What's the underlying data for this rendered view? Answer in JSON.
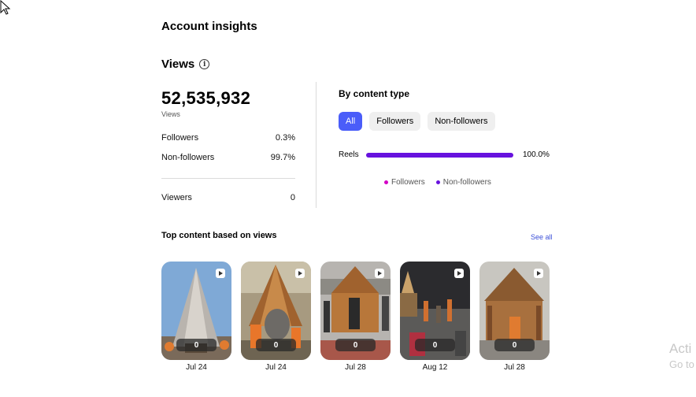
{
  "header": {
    "title": "Account insights"
  },
  "views": {
    "heading": "Views",
    "total": "52,535,932",
    "total_label": "Views",
    "followers_label": "Followers",
    "followers_pct": "0.3%",
    "nonfollowers_label": "Non-followers",
    "nonfollowers_pct": "99.7%",
    "viewers_label": "Viewers",
    "viewers_value": "0"
  },
  "by_content": {
    "title": "By content type",
    "tabs": [
      "All",
      "Followers",
      "Non-followers"
    ],
    "active_tab": "All",
    "bar_label": "Reels",
    "bar_value": "100.0%",
    "bar_fraction": 1.0,
    "legend": [
      {
        "label": "Followers",
        "color": "#d300c5"
      },
      {
        "label": "Non-followers",
        "color": "#6712de"
      }
    ]
  },
  "top_content": {
    "title": "Top content based on views",
    "see_all": "See all",
    "items": [
      {
        "count": "0",
        "date": "Jul 24"
      },
      {
        "count": "0",
        "date": "Jul 24"
      },
      {
        "count": "0",
        "date": "Jul 28"
      },
      {
        "count": "0",
        "date": "Aug 12"
      },
      {
        "count": "0",
        "date": "Jul 28"
      }
    ]
  },
  "watermark": {
    "line1": "Acti",
    "line2": "Go to"
  },
  "colors": {
    "accent": "#4a5df9",
    "bar": "#6712de",
    "link": "#3b4fd8"
  }
}
